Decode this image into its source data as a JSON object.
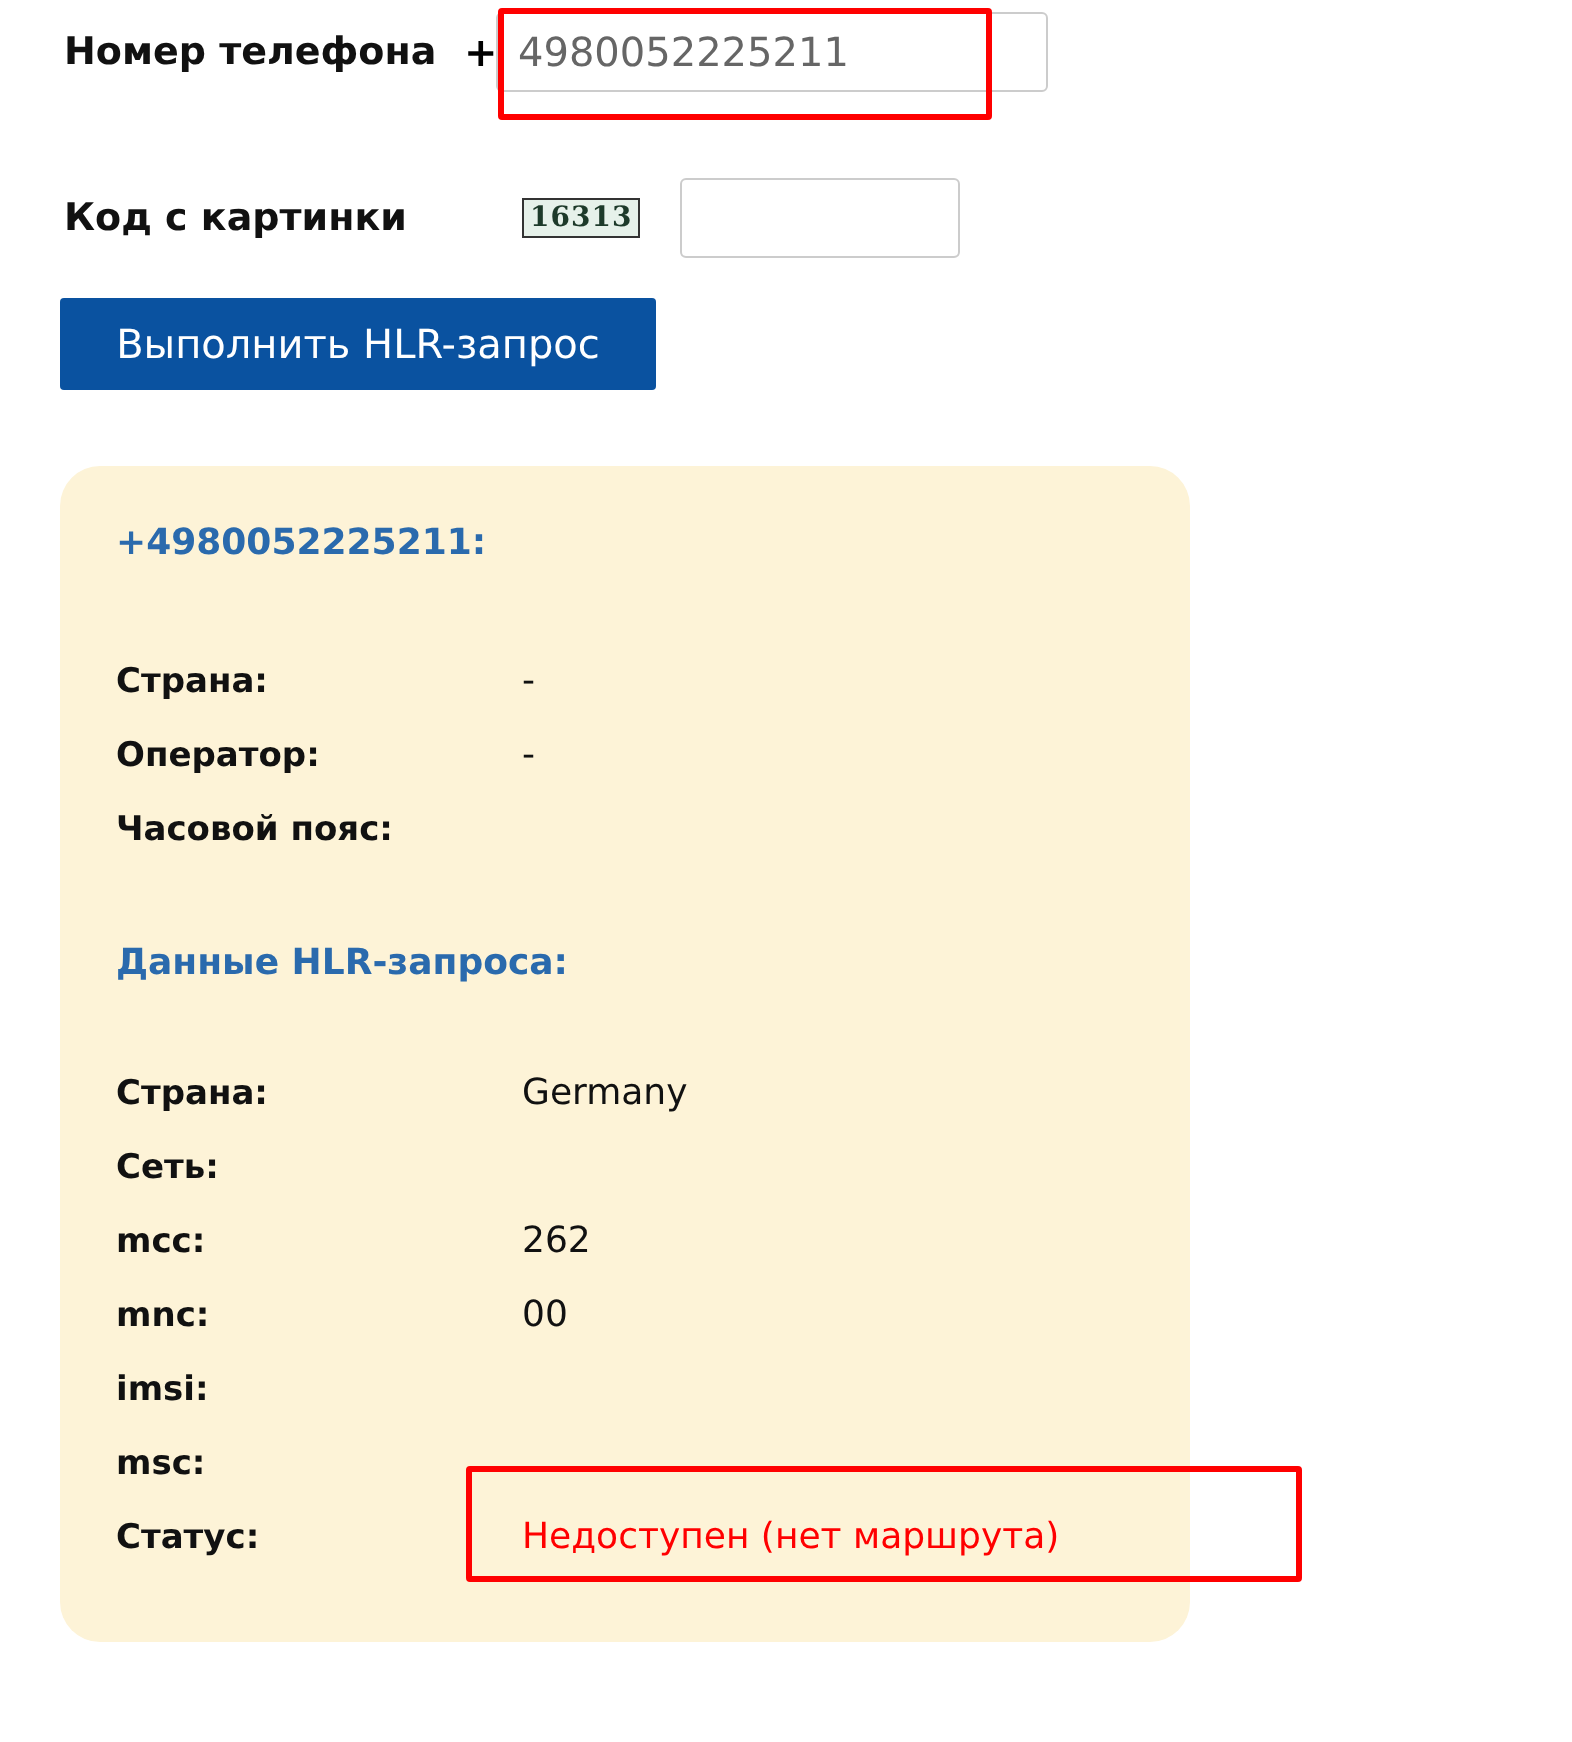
{
  "form": {
    "phone_label": "Номер телефона",
    "phone_prefix": "+",
    "phone_value": "4980052225211",
    "phone_highlighted": true,
    "captcha_label": "Код с картинки",
    "captcha_code": "16313",
    "submit": "Выполнить HLR-запрос"
  },
  "result": {
    "title": "+4980052225211:",
    "info_rows": [
      {
        "label": "Страна:",
        "value": "-"
      },
      {
        "label": "Оператор:",
        "value": "-"
      },
      {
        "label": "Часовой пояс:"
      }
    ],
    "hlr_title": "Данные HLR-запроса:",
    "hlr_rows": [
      {
        "label": "Страна:",
        "value": "Germany"
      },
      {
        "label": "Сеть:"
      },
      {
        "label": "mcc:",
        "value": "262"
      },
      {
        "label": "mnc:",
        "value": "00"
      },
      {
        "label": "imsi:"
      },
      {
        "label": "msc:"
      }
    ],
    "status": {
      "label": "Статус:",
      "value": "Недоступен (нет маршрута)",
      "highlighted": true
    }
  }
}
